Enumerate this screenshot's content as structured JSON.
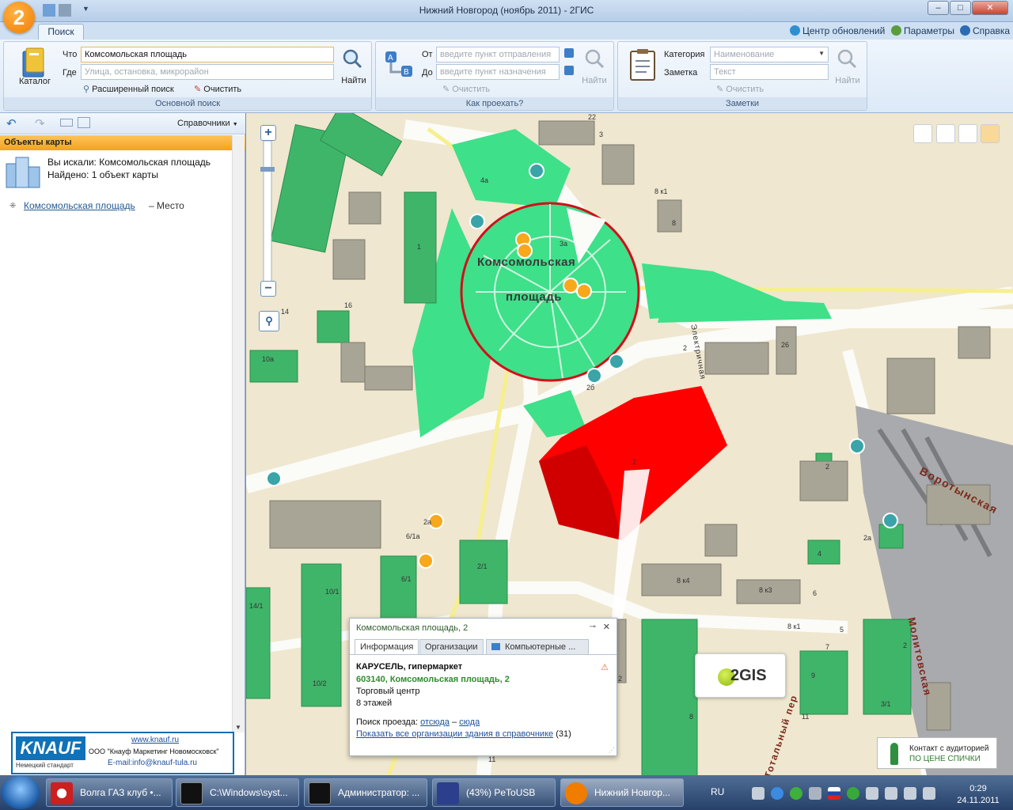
{
  "window": {
    "title": "Нижний Новгород (ноябрь 2011) - 2ГИС",
    "app_logo": "2",
    "controls": [
      "–",
      "□",
      "✕"
    ]
  },
  "ribbon": {
    "tab": "Поиск",
    "links": {
      "update_center": "Центр обновлений",
      "params": "Параметры",
      "help": "Справка"
    },
    "main_search": {
      "catalog": "Каталог",
      "what_label": "Что",
      "what_value": "Комсомольская площадь",
      "where_label": "Где",
      "where_placeholder": "Улица, остановка, микрорайон",
      "find": "Найти",
      "advanced": "Расширенный поиск",
      "clear": "Очистить",
      "group_label": "Основной поиск"
    },
    "route": {
      "from_label": "От",
      "from_placeholder": "введите пункт отправления",
      "to_label": "До",
      "to_placeholder": "введите пункт назначения",
      "find": "Найти",
      "clear": "Очистить",
      "group_label": "Как проехать?"
    },
    "notes": {
      "category_label": "Категория",
      "category_placeholder": "Наименование",
      "note_label": "Заметка",
      "note_placeholder": "Текст",
      "find": "Найти",
      "clear": "Очистить",
      "group_label": "Заметки"
    }
  },
  "left": {
    "directories": "Справочники",
    "header": "Объекты карты",
    "searched": "Вы искали: Комсомольская площадь",
    "found": "Найдено: 1 объект карты",
    "result_name": "Комсомольская площадь",
    "result_type": "– Место",
    "ad": {
      "logo": "KNAUF",
      "tagline": "Немецкий стандарт",
      "url": "www.knauf.ru",
      "company": "ООО \"Кнауф Маркетинг Новомосковск\"",
      "email": "E-mail:info@knauf-tula.ru"
    }
  },
  "map": {
    "place_line1": "Комсомольская",
    "place_line2": "площадь",
    "streets": {
      "vorotynskaya": "Воротынская",
      "molitovskaya": "Молитовская",
      "elektrichnaya": "Электричная",
      "totalny": "Тотальный пер"
    },
    "building_numbers": [
      "22",
      "3",
      "8 к1",
      "8",
      "1",
      "16",
      "14",
      "10а",
      "3а",
      "2",
      "26",
      "2",
      "2",
      "4",
      "2а",
      "6",
      "8 к3",
      "8 к4",
      "2а",
      "6/1",
      "2/1",
      "10/1",
      "14/1",
      "10/2",
      "6/1а",
      "4а",
      "8 к1",
      "5",
      "7",
      "9",
      "11",
      "3/1",
      "2",
      "11",
      "8",
      "2",
      "2б"
    ],
    "popup": {
      "title": "Комсомольская площадь, 2",
      "tabs": [
        "Информация",
        "Организации",
        "Компьютерные ..."
      ],
      "name": "КАРУСЕЛЬ, гипермаркет",
      "address": "603140, Комсомольская площадь, 2",
      "kind": "Торговый центр",
      "floors": "8 этажей",
      "route_label": "Поиск проезда:",
      "route_from": "отсюда",
      "route_dash": "–",
      "route_to": "сюда",
      "all_orgs": "Показать все организации здания в справочнике",
      "count": "(31)"
    },
    "logo": "2GIS",
    "ad_line1": "Контакт с аудиторией",
    "ad_line2": "ПО ЦЕНЕ СПИЧКИ"
  },
  "taskbar": {
    "items": [
      "Волга ГАЗ клуб •...",
      "C:\\Windows\\syst...",
      "Администратор: ...",
      "(43%) PeToUSB",
      "Нижний Новгор..."
    ],
    "lang": "RU",
    "time": "0:29",
    "date": "24.11.2011"
  },
  "colors": {
    "accent_orange": "#f7a81b",
    "park_green": "#3ee08a",
    "highlight_red": "#ff0000",
    "circle_red": "#d0101a",
    "building_green": "#3fb56a"
  }
}
